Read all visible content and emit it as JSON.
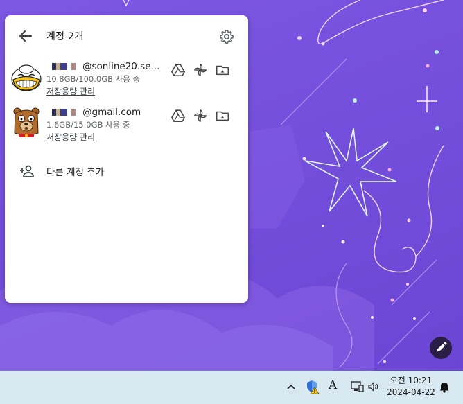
{
  "panel": {
    "title": "계정 2개",
    "accounts": [
      {
        "avatar": "duck-avatar-icon",
        "email": "@sonline20.se...",
        "usage": "10.8GB/100.0GB 사용 중",
        "manage_label": "저장용량 관리"
      },
      {
        "avatar": "bear-avatar-icon",
        "email": "@gmail.com",
        "usage": "1.6GB/15.0GB 사용 중",
        "manage_label": "저장용량 관리"
      }
    ],
    "add_account_label": "다른 계정 추가"
  },
  "taskbar": {
    "clock_time": "오전 10:21",
    "clock_date": "2024-04-22",
    "ime_mode": "A"
  },
  "colors": {
    "wallpaper": "#744fdc",
    "taskbar": "#d8e9f2",
    "fab": "#2a1e47"
  }
}
